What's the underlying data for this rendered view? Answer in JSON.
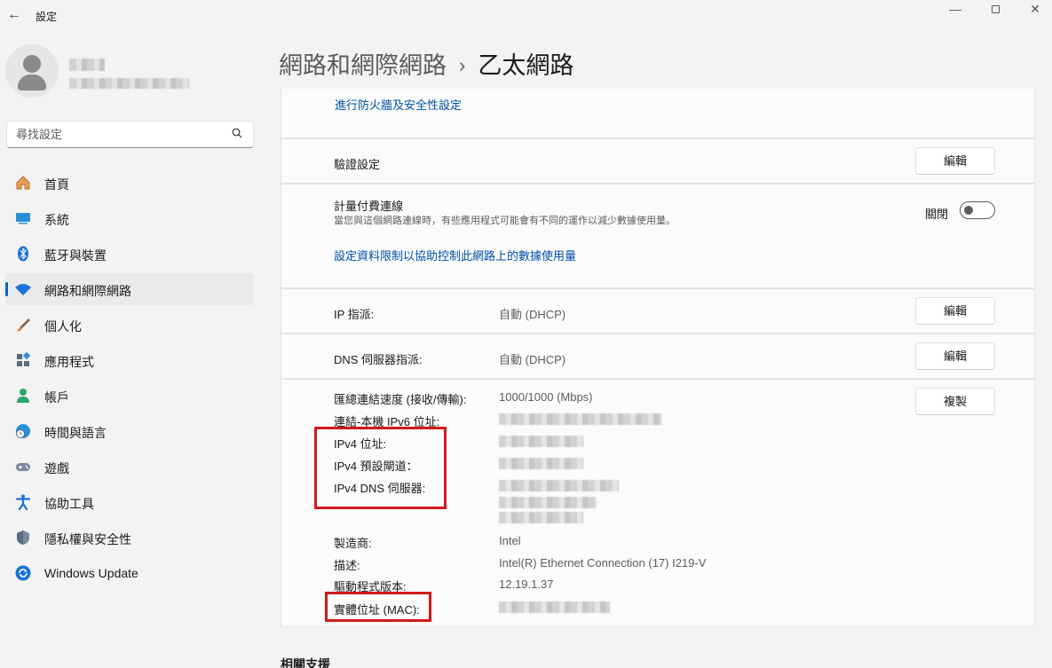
{
  "window": {
    "back_glyph": "←",
    "title": "設定",
    "minimize_glyph": "—",
    "close_glyph": "✕"
  },
  "search": {
    "placeholder": "尋找設定"
  },
  "nav": [
    {
      "label": "首頁",
      "icon": "home-icon"
    },
    {
      "label": "系統",
      "icon": "system-icon"
    },
    {
      "label": "藍牙與裝置",
      "icon": "bluetooth-icon"
    },
    {
      "label": "網路和網際網路",
      "icon": "wifi-icon",
      "active": true
    },
    {
      "label": "個人化",
      "icon": "brush-icon"
    },
    {
      "label": "應用程式",
      "icon": "apps-icon"
    },
    {
      "label": "帳戶",
      "icon": "account-icon"
    },
    {
      "label": "時間與語言",
      "icon": "time-language-icon"
    },
    {
      "label": "遊戲",
      "icon": "gamepad-icon"
    },
    {
      "label": "協助工具",
      "icon": "accessibility-icon"
    },
    {
      "label": "隱私權與安全性",
      "icon": "shield-icon"
    },
    {
      "label": "Windows Update",
      "icon": "windows-update-icon"
    }
  ],
  "breadcrumb": {
    "parent": "網路和網際網路",
    "separator": "›",
    "current": "乙太網路"
  },
  "firewall_link": "進行防火牆及安全性設定",
  "auth": {
    "label": "驗證設定",
    "button": "編輯"
  },
  "metered": {
    "title": "計量付費連線",
    "description": "當您與這個網路連線時，有些應用程式可能會有不同的運作以減少數據使用量。",
    "toggle_label": "關閉",
    "toggle_on": false,
    "data_limit_link": "設定資料限制以協助控制此網路上的數據使用量"
  },
  "ip": {
    "label": "IP 指派:",
    "value": "自動 (DHCP)",
    "button": "編輯"
  },
  "dns": {
    "label": "DNS 伺服器指派:",
    "value": "自動 (DHCP)",
    "button": "編輯"
  },
  "properties": {
    "copy_button": "複製",
    "rows": [
      {
        "label": "匯總連結速度 (接收/傳輸):",
        "value": "1000/1000 (Mbps)"
      },
      {
        "label": "連結-本機 IPv6 位址:",
        "value": ""
      },
      {
        "label": "IPv4 位址:",
        "value": ""
      },
      {
        "label": "IPv4 預設閘道：",
        "value": ""
      },
      {
        "label": "IPv4 DNS 伺服器:",
        "value": ""
      },
      {
        "label": "製造商:",
        "value": "Intel"
      },
      {
        "label": "描述:",
        "value": "Intel(R) Ethernet Connection (17) I219-V"
      },
      {
        "label": "驅動程式版本:",
        "value": "12.19.1.37"
      },
      {
        "label": "實體位址 (MAC):",
        "value": ""
      }
    ]
  },
  "related": "相關支援",
  "colors": {
    "accent": "#0067c0",
    "link": "#0050a8",
    "highlight": "#d11a1a"
  }
}
